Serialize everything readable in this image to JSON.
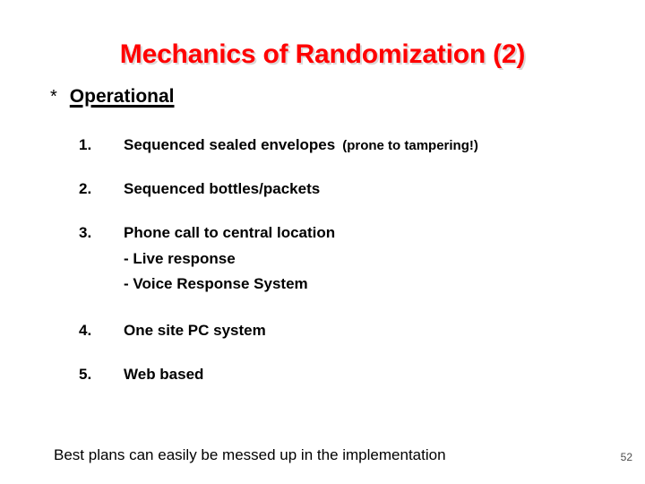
{
  "slide": {
    "title": "Mechanics of Randomization (2)",
    "title_color": "#ff0000",
    "section": {
      "bullet": "*",
      "label": "Operational"
    },
    "items": [
      {
        "number": "1.",
        "text": "Sequenced sealed envelopes",
        "note": "(prone to tampering!)",
        "sublines": []
      },
      {
        "number": "2.",
        "text": "Sequenced bottles/packets",
        "note": "",
        "sublines": []
      },
      {
        "number": "3.",
        "text": "Phone call to central location",
        "note": "",
        "sublines": [
          "- Live response",
          "- Voice Response System"
        ]
      },
      {
        "number": "4.",
        "text": "One site PC system",
        "note": "",
        "sublines": []
      },
      {
        "number": "5.",
        "text": "Web based",
        "note": "",
        "sublines": []
      }
    ],
    "footer_note": "Best plans can easily be messed up in the implementation",
    "page_number": "52"
  }
}
